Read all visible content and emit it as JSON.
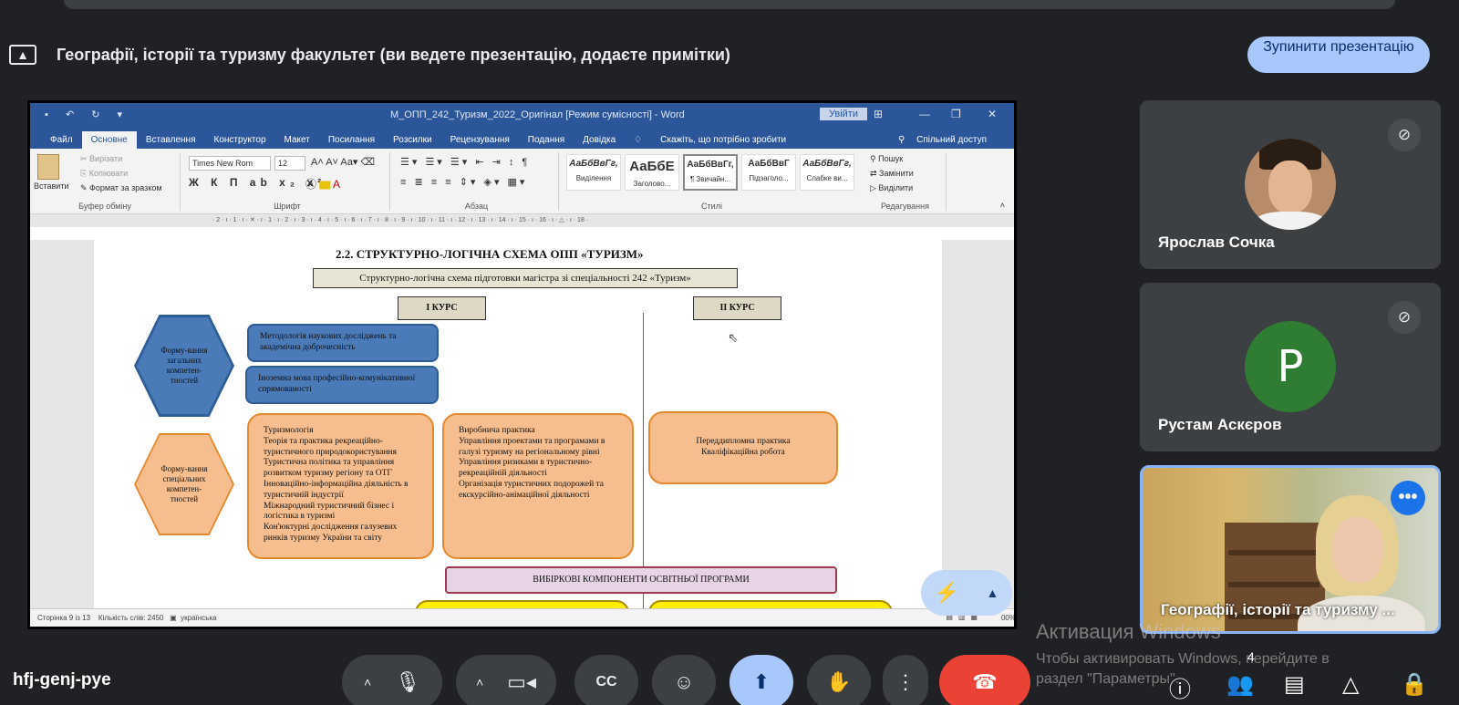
{
  "presentation": {
    "title": "Географії, історії та туризму факультет (ви ведете презентацію, додаєте примітки)",
    "stop_label": "Зупинити презентацію"
  },
  "word": {
    "doc_title": "М_ОПП_242_Туризм_2022_Оригінал [Режим сумісності] - Word",
    "signin_label": "Увійти",
    "tabs": [
      "Файл",
      "Основне",
      "Вставлення",
      "Конструктор",
      "Макет",
      "Посилання",
      "Розсилки",
      "Рецензування",
      "Подання",
      "Довідка"
    ],
    "active_tab": "Основне",
    "tell_me": "Скажіть, що потрібно зробити",
    "share_label": "Спільний доступ",
    "clipboard": {
      "paste": "Вставити",
      "cut": "Вирізати",
      "copy": "Копіювати",
      "format_painter": "Формат за зразком",
      "group": "Буфер обміну"
    },
    "font": {
      "name": "Times New Rom",
      "size": "12",
      "group": "Шрифт"
    },
    "paragraph_group": "Абзац",
    "styles": [
      {
        "preview": "АаБбВвГг,",
        "label": "Виділення"
      },
      {
        "preview": "АаБбЕ",
        "label": "Заголово..."
      },
      {
        "preview": "АаБбВвГг,",
        "label": "¶ Звичайн..."
      },
      {
        "preview": "АаБбВвГ",
        "label": "Підзаголо..."
      },
      {
        "preview": "АаБбВвГг,",
        "label": "Слабке ви..."
      }
    ],
    "styles_group": "Стилі",
    "editing": {
      "find": "Пошук",
      "replace": "Замінити",
      "select": "Виділити",
      "group": "Редагування"
    },
    "ruler": "· 2 · ı · 1 · ı · ✕ · ı · 1 · ı · 2 · ı · 3 · ı · 4 · ı · 5 · ı · 6 · ı · 7 · ı · 8 · ı · 9 · ı · 10 · ı · 11 · ı · 12 · ı · 13 · ı · 14 · ı · 15 · ı · 16 · ı · △ · ı · 18 ·",
    "status": {
      "page": "Сторінка 9 із 13",
      "words": "Кількість слів: 2450",
      "language": "українська",
      "zoom": "00%"
    }
  },
  "document": {
    "heading": "2.2. СТРУКТУРНО-ЛОГІЧНА СХЕМА ОПП «ТУРИЗМ»",
    "subheading": "Структурно-логічна схема підготовки магістра зі спеціальності 242 «Туризм»",
    "course1": "І КУРС",
    "course2": "ІІ КУРС",
    "hex_general": "Форму-вання загальних компетен-тностей",
    "hex_special": "Форму-вання спеціальних компетен-тностей",
    "blue_box1": "Методологія наукових досліджень та академічна доброчесність",
    "blue_box2": "Іноземна мова професійно-комунікативної спрямованості",
    "orange_box1": "Туризмологія\nТеорія та практика рекреаційно-туристичного природокористування\nТуристична політика та управління розвитком туризму регіону та ОТГ\nІнноваційно-інформаційна діяльність в туристичній індустрії\nМіжнародний туристичний бізнес і логістика в туризмі\nКон'юктурні дослідження галузевих ринків туризму України та світу",
    "orange_box2": "Виробнича практика\nУправління проектами та програмами в галузі туризму на регіональному рівні\nУправління ризиками в туристично-рекреаційній діяльності\nОрганізація туристичних подорожей та екскурсійно-анімаційної діяльності",
    "orange_box3": "Переддипломна практика\nКваліфікаційна робота",
    "elective": "ВИБІРКОВІ КОМПОНЕНТИ ОСВІТНЬОЇ ПРОГРАМИ"
  },
  "participants": [
    {
      "name": "Ярослав Сочка",
      "muted": true
    },
    {
      "name": "Рустам Аскєров",
      "initial": "P",
      "muted": true
    },
    {
      "name": "Географії, історії та туризму ..."
    }
  ],
  "activation": {
    "title": "Активация Windows",
    "line1": "Чтобы активировать Windows, перейдите в",
    "line2": "раздел \"Параметры\"."
  },
  "meeting": {
    "code": "hfj-genj-pye",
    "participants_count": "4"
  }
}
